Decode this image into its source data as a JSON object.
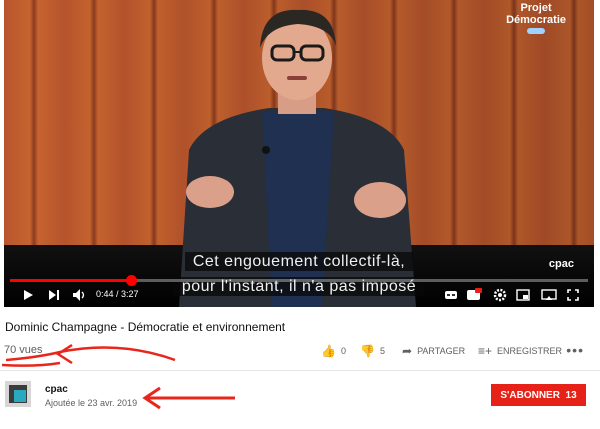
{
  "overlay": {
    "brand_line1": "Projet",
    "brand_line2": "Démocratie",
    "logo": "cpac"
  },
  "captions": {
    "line1": "Cet engouement collectif-là,",
    "line2": "pour l'instant, il n'a pas imposé"
  },
  "player": {
    "time": "0:44 / 3:27",
    "progress_fraction": 0.21,
    "icons": [
      "play-icon",
      "next-icon",
      "volume-icon",
      "subtitles-icon",
      "settings-icon",
      "miniplayer-icon",
      "theater-icon",
      "cast-icon",
      "fullscreen-icon"
    ]
  },
  "video": {
    "title": "Dominic Champagne - Démocratie et environnement",
    "views": "70 vues"
  },
  "actions": {
    "like_count": "0",
    "dislike_count": "5",
    "share_label": "PARTAGER",
    "save_label": "ENREGISTRER"
  },
  "channel": {
    "name": "cpac",
    "added": "Ajoutée le 23 avr. 2019"
  },
  "subscribe": {
    "label": "S'ABONNER",
    "count": "13 K"
  },
  "colors": {
    "accent_red": "#e62117",
    "annotation_red": "#e8261b"
  }
}
